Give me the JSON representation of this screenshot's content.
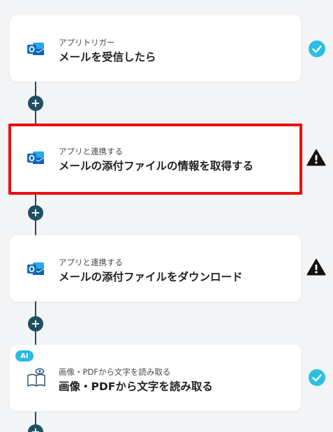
{
  "steps": [
    {
      "subtitle": "アプリトリガー",
      "title": "メールを受信したら",
      "app_icon": "outlook-icon",
      "status": "check"
    },
    {
      "subtitle": "アプリと連携する",
      "title": "メールの添付ファイルの情報を取得する",
      "app_icon": "outlook-icon",
      "status": "warning"
    },
    {
      "subtitle": "アプリと連携する",
      "title": "メールの添付ファイルをダウンロード",
      "app_icon": "outlook-icon",
      "status": "warning"
    },
    {
      "subtitle": "画像・PDFから文字を読み取る",
      "title": "画像・PDFから文字を読み取る",
      "app_icon": "ocr-book-eye-icon",
      "status": "check",
      "badge": "AI"
    }
  ],
  "plus_label": "+",
  "colors": {
    "connector": "#1f4f63",
    "check": "#2bc0e0",
    "warning": "#111111",
    "selected_border": "#e81010",
    "background": "#f3f4f6"
  }
}
